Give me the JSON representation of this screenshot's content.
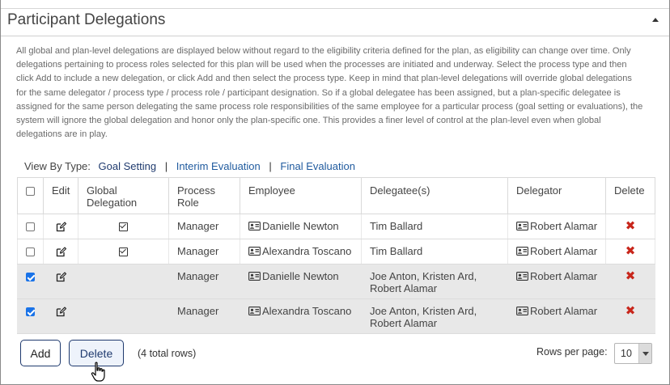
{
  "section": {
    "title": "Participant Delegations",
    "description": "All global and plan-level delegations are displayed below without regard to the eligibility criteria defined for the plan, as eligibility can change over time. Only delegations pertaining to process roles selected for this plan will be used when the processes are initiated and underway. Select the process type and then click Add to include a new delegation, or click Add and then select the process type. Keep in mind that plan-level delegations will override global delegations for the same delegator / process type / process role / participant designation. So if a global delegatee has been assigned, but a plan-specific delegatee is assigned for the same person delegating the same process role responsibilities of the same employee for a particular process (goal setting or evaluations), the system will ignore the global delegation and honor only the plan-specific one. This provides a finer level of control at the plan-level even when global delegations are in play."
  },
  "view_by": {
    "label": "View By Type:",
    "types": [
      "Goal Setting",
      "Interim Evaluation",
      "Final Evaluation"
    ],
    "separator": "|"
  },
  "table": {
    "columns": {
      "edit": "Edit",
      "global_delegation": "Global Delegation",
      "process_role": "Process Role",
      "employee": "Employee",
      "delegatees": "Delegatee(s)",
      "delegator": "Delegator",
      "delete": "Delete"
    },
    "rows": [
      {
        "selected": false,
        "global": true,
        "process_role": "Manager",
        "employee": "Danielle Newton",
        "delegatees": "Tim Ballard",
        "delegator": "Robert Alamar"
      },
      {
        "selected": false,
        "global": true,
        "process_role": "Manager",
        "employee": "Alexandra Toscano",
        "delegatees": "Tim Ballard",
        "delegator": "Robert Alamar"
      },
      {
        "selected": true,
        "global": false,
        "process_role": "Manager",
        "employee": "Danielle Newton",
        "delegatees": "Joe Anton, Kristen Ard, Robert Alamar",
        "delegator": "Robert Alamar"
      },
      {
        "selected": true,
        "global": false,
        "process_role": "Manager",
        "employee": "Alexandra Toscano",
        "delegatees": "Joe Anton, Kristen Ard, Robert Alamar",
        "delegator": "Robert Alamar"
      }
    ]
  },
  "footer": {
    "add_label": "Add",
    "delete_label": "Delete",
    "total_rows": "(4 total rows)",
    "rows_per_page_label": "Rows per page:",
    "rows_per_page_value": "10"
  },
  "icons": {
    "delete_color": "#c8261b",
    "checkbox_checked_color": "#1a73e8",
    "link_color": "#1f5a9e"
  }
}
